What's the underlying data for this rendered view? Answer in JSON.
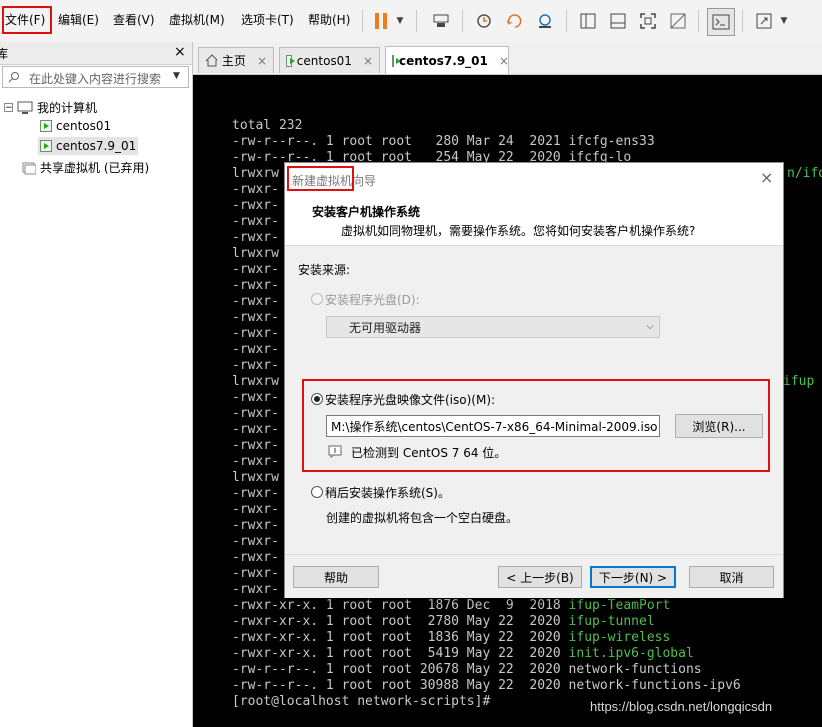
{
  "menu": {
    "file": "文件(F)",
    "edit": "编辑(E)",
    "view": "查看(V)",
    "vm": "虚拟机(M)",
    "tabs": "选项卡(T)",
    "help": "帮助(H)"
  },
  "toolbar_icons": [
    "pause-icon",
    "dropdown-icon",
    "send-keys-icon",
    "snapshot-icon",
    "revert-snapshot-icon",
    "manage-snapshots-icon",
    "sidebar-view-icon",
    "single-view-icon",
    "fullscreen-icon",
    "unity-icon",
    "console-icon",
    "stretch-icon"
  ],
  "library": {
    "title": "库",
    "close": "×",
    "search_placeholder": "在此处键入内容进行搜索",
    "root": "我的计算机",
    "items": [
      {
        "label": "centos01"
      },
      {
        "label": "centos7.9_01"
      }
    ],
    "shared": "共享虚拟机 (已弃用)"
  },
  "tabs": [
    {
      "label": "主页",
      "close": "×"
    },
    {
      "label": "centos01",
      "close": "×"
    },
    {
      "label": "centos7.9_01",
      "close": "×"
    }
  ],
  "terminal": {
    "lines": [
      {
        "plain": "total 232",
        "green": ""
      },
      {
        "plain": "-rw-r--r--. 1 root root   280 Mar 24  2021 ",
        "green": "",
        "rest": "ifcfg-ens33"
      },
      {
        "plain": "-rw-r--r--. 1 root root   254 May 22  2020 ",
        "green": "",
        "rest": "ifcfg-lo"
      },
      {
        "plain": "lrwxrw",
        "green": "",
        "rest": ""
      },
      {
        "plain": "-rwxr-",
        "green": ""
      },
      {
        "plain": "-rwxr-",
        "green": ""
      },
      {
        "plain": "-rwxr-",
        "green": ""
      },
      {
        "plain": "-rwxr-",
        "green": ""
      },
      {
        "plain": "lrwxrw",
        "green": ""
      },
      {
        "plain": "-rwxr-",
        "green": ""
      },
      {
        "plain": "-rwxr-",
        "green": ""
      },
      {
        "plain": "-rwxr-",
        "green": ""
      },
      {
        "plain": "-rwxr-",
        "green": ""
      },
      {
        "plain": "-rwxr-",
        "green": ""
      },
      {
        "plain": "-rwxr-",
        "green": ""
      },
      {
        "plain": "-rwxr-",
        "green": ""
      },
      {
        "plain": "lrwxrw",
        "green": ""
      },
      {
        "plain": "-rwxr-",
        "green": ""
      },
      {
        "plain": "-rwxr-",
        "green": ""
      },
      {
        "plain": "-rwxr-",
        "green": ""
      },
      {
        "plain": "-rwxr-",
        "green": ""
      },
      {
        "plain": "-rwxr-",
        "green": ""
      },
      {
        "plain": "lrwxrw",
        "green": ""
      },
      {
        "plain": "-rwxr-",
        "green": ""
      },
      {
        "plain": "-rwxr-",
        "green": ""
      },
      {
        "plain": "-rwxr-",
        "green": ""
      },
      {
        "plain": "-rwxr-",
        "green": ""
      },
      {
        "plain": "-rwxr-",
        "green": ""
      },
      {
        "plain": "-rwxr-",
        "green": ""
      },
      {
        "plain": "-rwxr-",
        "green": ""
      },
      {
        "plain": "-rwxr-xr-x. 1 root root  1876 Dec  9  2018 ",
        "green": "ifup-TeamPort"
      },
      {
        "plain": "-rwxr-xr-x. 1 root root  2780 May 22  2020 ",
        "green": "ifup-tunnel"
      },
      {
        "plain": "-rwxr-xr-x. 1 root root  1836 May 22  2020 ",
        "green": "ifup-wireless"
      },
      {
        "plain": "-rwxr-xr-x. 1 root root  5419 May 22  2020 ",
        "green": "init.ipv6-global"
      },
      {
        "plain": "-rw-r--r--. 1 root root 20678 May 22  2020 ",
        "green": "",
        "rest": "network-functions"
      },
      {
        "plain": "-rw-r--r--. 1 root root 30988 May 22  2020 ",
        "green": "",
        "rest": "network-functions-ipv6"
      },
      {
        "plain": "[root@localhost network-scripts]#",
        "green": ""
      }
    ],
    "right_fragments": [
      "n/ifd",
      "ifup"
    ]
  },
  "dialog": {
    "title_prefix": "新建虚拟机",
    "title_suffix": "向导",
    "close": "×",
    "heading": "安装客户机操作系统",
    "subheading": "虚拟机如同物理机，需要操作系统。您将如何安装客户机操作系统?",
    "source_label": "安装来源:",
    "option_disc": "安装程序光盘(D):",
    "disc_select": "无可用驱动器",
    "option_iso": "安装程序光盘映像文件(iso)(M):",
    "iso_path": "M:\\操作系统\\centos\\CentOS-7-x86_64-Minimal-2009.iso",
    "browse": "浏览(R)...",
    "detected": "已检测到 CentOS 7 64 位。",
    "option_later": "稍后安装操作系统(S)。",
    "later_desc": "创建的虚拟机将包含一个空白硬盘。",
    "btn_help": "帮助",
    "btn_back": "< 上一步(B)",
    "btn_next": "下一步(N) >",
    "btn_cancel": "取消"
  },
  "watermark": "https://blog.csdn.net/longqicsdn",
  "colors": {
    "highlight": "#e01010",
    "terminal_green": "#4ec04e",
    "terminal_bg": "#000000"
  }
}
